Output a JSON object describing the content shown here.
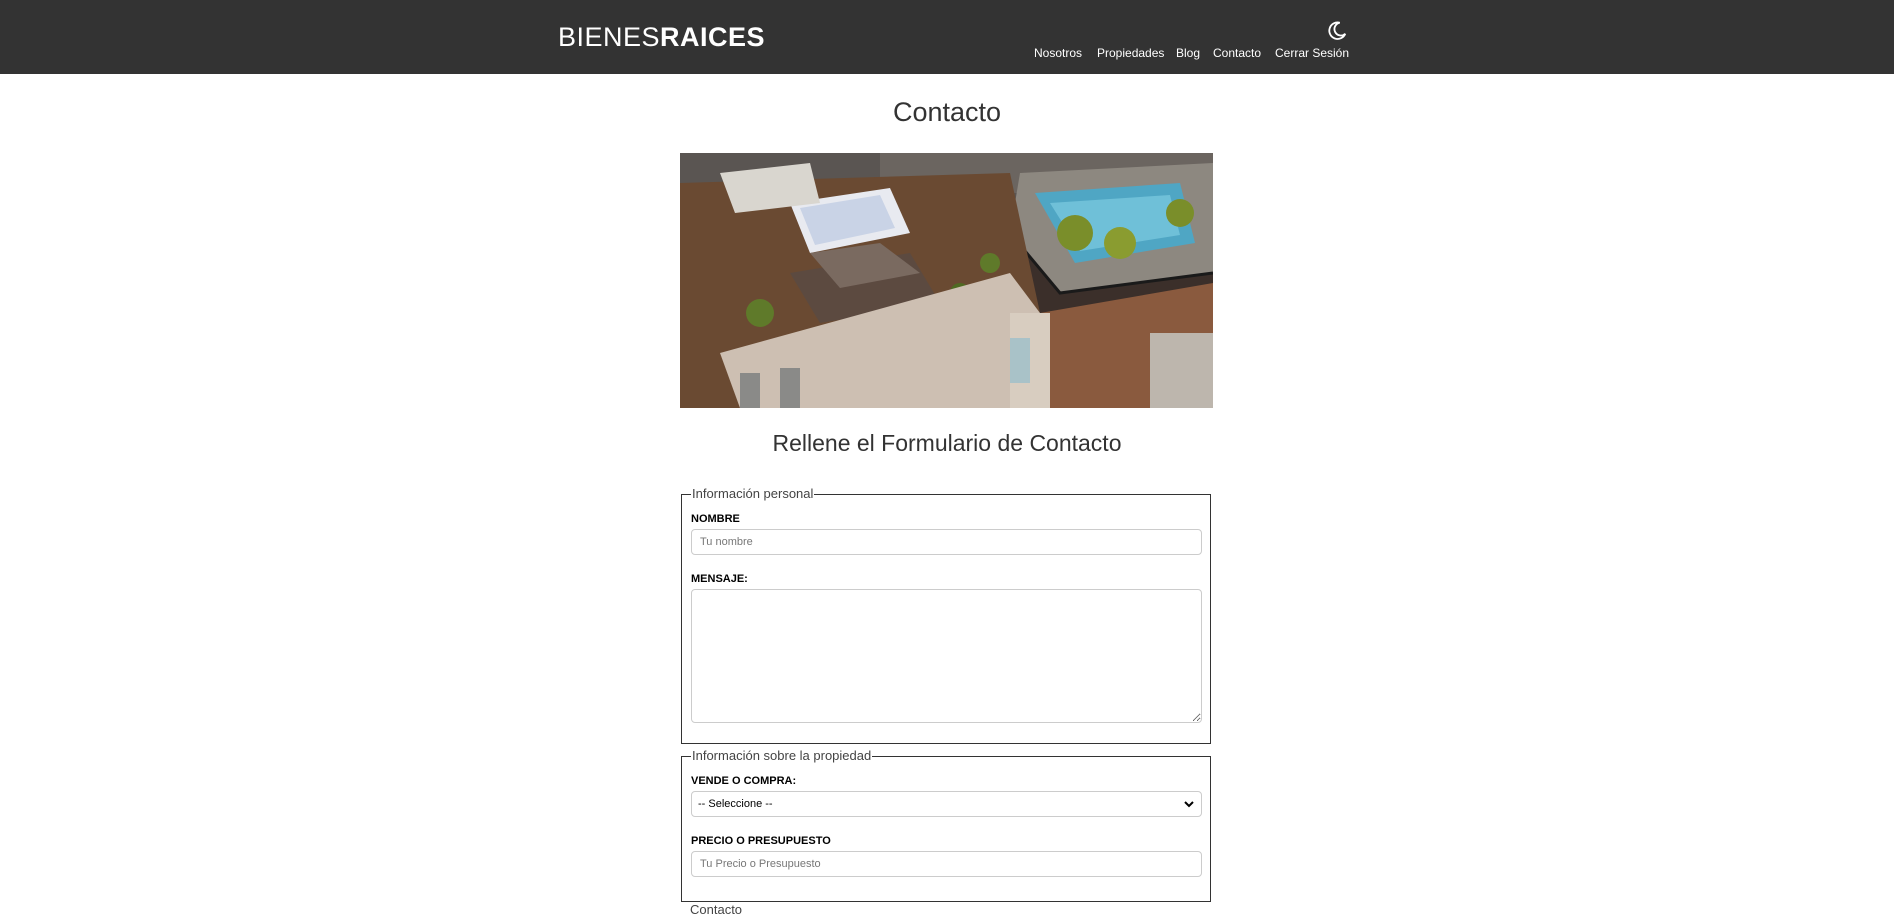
{
  "header": {
    "logo_light": "BIENES",
    "logo_bold": "RAICES",
    "theme_toggle_icon": "moon-icon",
    "nav": [
      "Nosotros",
      "Propiedades",
      "Blog",
      "Contacto",
      "Cerrar Sesión"
    ]
  },
  "main": {
    "title": "Contacto",
    "form_title": "Rellene el Formulario de Contacto"
  },
  "form": {
    "personal": {
      "legend": "Información personal",
      "name_label": "NOMBRE",
      "name_placeholder": "Tu nombre",
      "message_label": "MENSAJE:"
    },
    "property": {
      "legend": "Información sobre la propiedad",
      "buy_sell_label": "VENDE O COMPRA:",
      "buy_sell_value": "-- Seleccione --",
      "price_label": "PRECIO O PRESUPUESTO",
      "price_placeholder": "Tu Precio o Presupuesto"
    },
    "next_legend": "Contacto"
  },
  "colors": {
    "header_bg": "#333333",
    "text": "#333333"
  }
}
